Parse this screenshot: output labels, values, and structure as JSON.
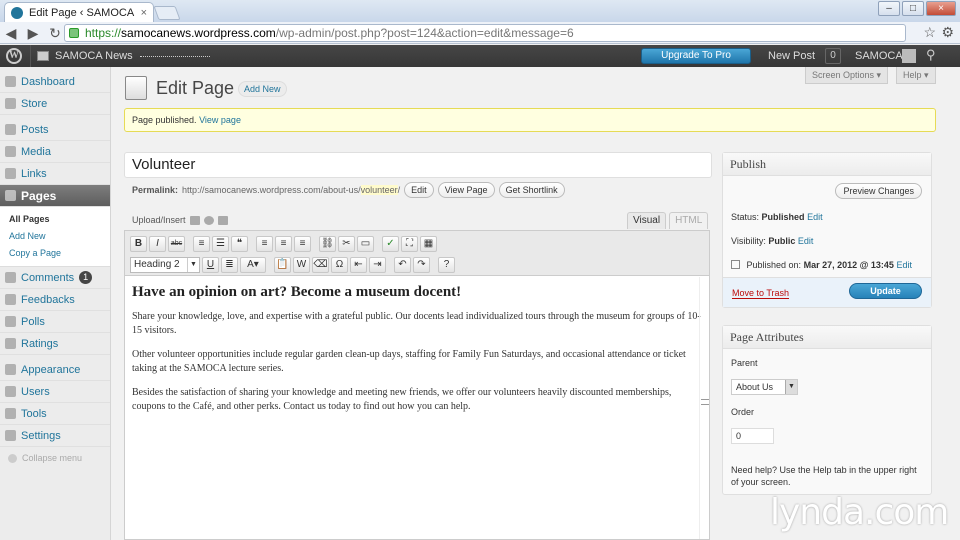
{
  "browser": {
    "tab_title": "Edit Page ‹ SAMOCA News",
    "tab_close": "×",
    "url_scheme": "https://",
    "url_host": "samocanews.wordpress.com",
    "url_path": "/wp-admin/post.php?post=124&action=edit&message=6",
    "window_min": "–",
    "window_max": "□",
    "window_close": "×"
  },
  "adminbar": {
    "site_name": "SAMOCA News",
    "upgrade_label": "Upgrade To Pro",
    "new_post": "New Post",
    "notifications": "0",
    "user": "SAMOCA"
  },
  "sidebar": {
    "items": [
      {
        "label": "Dashboard"
      },
      {
        "label": "Store"
      },
      {
        "label": "Posts"
      },
      {
        "label": "Media"
      },
      {
        "label": "Links"
      },
      {
        "label": "Pages"
      },
      {
        "label": "Comments",
        "badge": "1"
      },
      {
        "label": "Feedbacks"
      },
      {
        "label": "Polls"
      },
      {
        "label": "Ratings"
      },
      {
        "label": "Appearance"
      },
      {
        "label": "Users"
      },
      {
        "label": "Tools"
      },
      {
        "label": "Settings"
      }
    ],
    "pages_sub": [
      "All Pages",
      "Add New",
      "Copy a Page"
    ],
    "collapse": "Collapse menu"
  },
  "header": {
    "title": "Edit Page",
    "add_new": "Add New",
    "screen_options": "Screen Options ▾",
    "help": "Help ▾"
  },
  "notice": {
    "text": "Page published.",
    "link": "View page"
  },
  "post": {
    "title": "Volunteer",
    "permalink_label": "Permalink:",
    "permalink_base": "http://samocanews.wordpress.com/about-us/",
    "permalink_slug": "volunteer",
    "permalink_end": "/",
    "edit_btn": "Edit",
    "view_btn": "View Page",
    "shortlink_btn": "Get Shortlink"
  },
  "editor": {
    "upload_label": "Upload/Insert",
    "tab_visual": "Visual",
    "tab_html": "HTML",
    "format_select": "Heading 2",
    "heading": "Have an opinion on art? Become a museum docent!",
    "paragraphs": [
      "Share your knowledge, love, and expertise with a grateful public. Our docents lead individualized tours through the museum for groups of 10-15 visitors.",
      "Other volunteer opportunities include regular garden clean-up days, staffing for Family Fun Saturdays, and occasional attendance or ticket taking at the SAMOCA lecture series.",
      "Besides the satisfaction of sharing your knowledge and meeting new friends, we offer our volunteers heavily discounted memberships, coupons to the Café, and other perks. Contact us today to find out how you can help."
    ]
  },
  "publish": {
    "title": "Publish",
    "preview": "Preview Changes",
    "status_label": "Status:",
    "status_value": "Published",
    "visibility_label": "Visibility:",
    "visibility_value": "Public",
    "published_label": "Published on:",
    "published_value": "Mar 27, 2012 @ 13:45",
    "edit": "Edit",
    "trash": "Move to Trash",
    "update": "Update"
  },
  "attributes": {
    "title": "Page Attributes",
    "parent_label": "Parent",
    "parent_value": "About Us",
    "order_label": "Order",
    "order_value": "0",
    "help": "Need help? Use the Help tab in the upper right of your screen."
  },
  "watermark": "lynda.com"
}
